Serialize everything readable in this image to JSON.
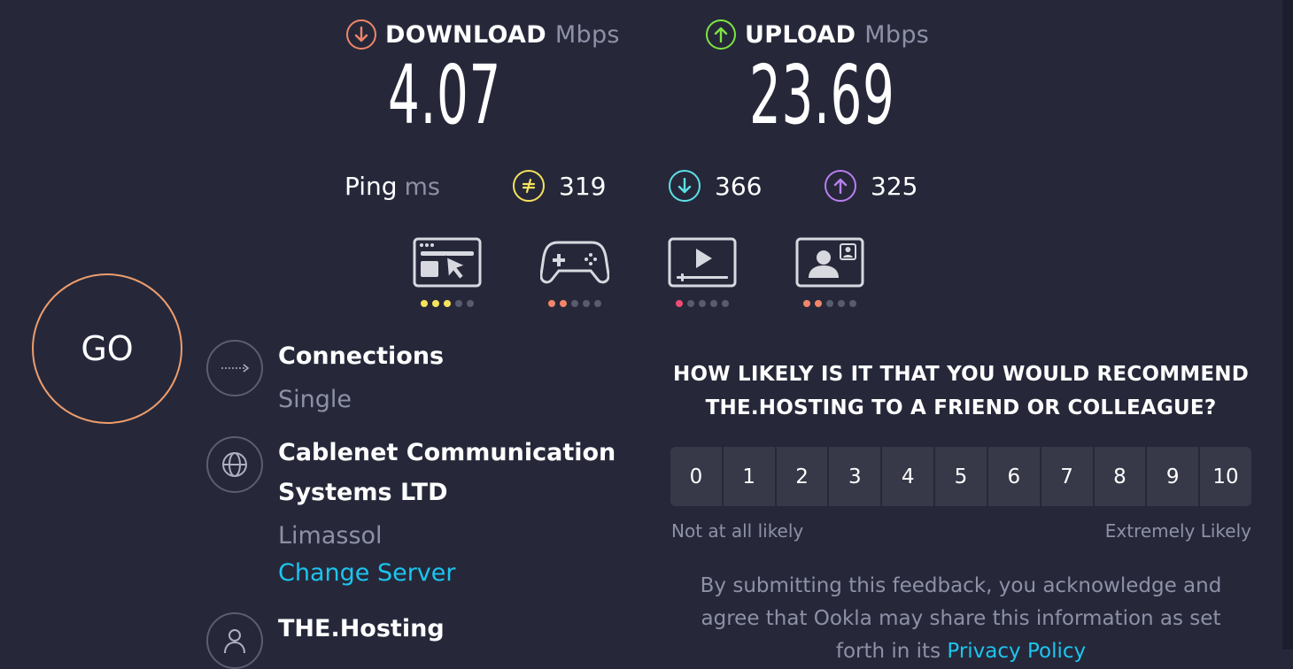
{
  "download": {
    "label": "DOWNLOAD",
    "unit": "Mbps",
    "value": "4.07",
    "color": "#f08668"
  },
  "upload": {
    "label": "UPLOAD",
    "unit": "Mbps",
    "value": "23.69",
    "color": "#7de541"
  },
  "ping": {
    "label": "Ping",
    "unit": "ms",
    "idle": "319",
    "down": "366",
    "up": "325",
    "idle_color": "#f7e35b",
    "down_color": "#5ee0e6",
    "up_color": "#b97ff0"
  },
  "apps": [
    {
      "icon": "web-browsing-icon",
      "rating": 3,
      "max": 5,
      "color": "#f7e35b"
    },
    {
      "icon": "gaming-controller-icon",
      "rating": 2,
      "max": 5,
      "color": "#f08668"
    },
    {
      "icon": "video-streaming-icon",
      "rating": 1,
      "max": 5,
      "color": "#f14a76"
    },
    {
      "icon": "video-chat-icon",
      "rating": 2,
      "max": 5,
      "color": "#f08668"
    }
  ],
  "go_label": "GO",
  "connections": {
    "title": "Connections",
    "value": "Single"
  },
  "server": {
    "title_line1": "Cablenet Communication",
    "title_line2": "Systems LTD",
    "location": "Limassol",
    "change_link": "Change Server"
  },
  "host": {
    "title": "THE.Hosting"
  },
  "survey": {
    "question_line1": "HOW LIKELY IS IT THAT YOU WOULD RECOMMEND",
    "question_line2": "THE.HOSTING TO A FRIEND OR COLLEAGUE?",
    "scale": [
      "0",
      "1",
      "2",
      "3",
      "4",
      "5",
      "6",
      "7",
      "8",
      "9",
      "10"
    ],
    "low_label": "Not at all likely",
    "high_label": "Extremely Likely",
    "disclaimer_line1": "By submitting this feedback, you acknowledge and",
    "disclaimer_line2": "agree that Ookla may share this information as set",
    "disclaimer_line3": "forth in its ",
    "privacy_link": "Privacy Policy"
  }
}
